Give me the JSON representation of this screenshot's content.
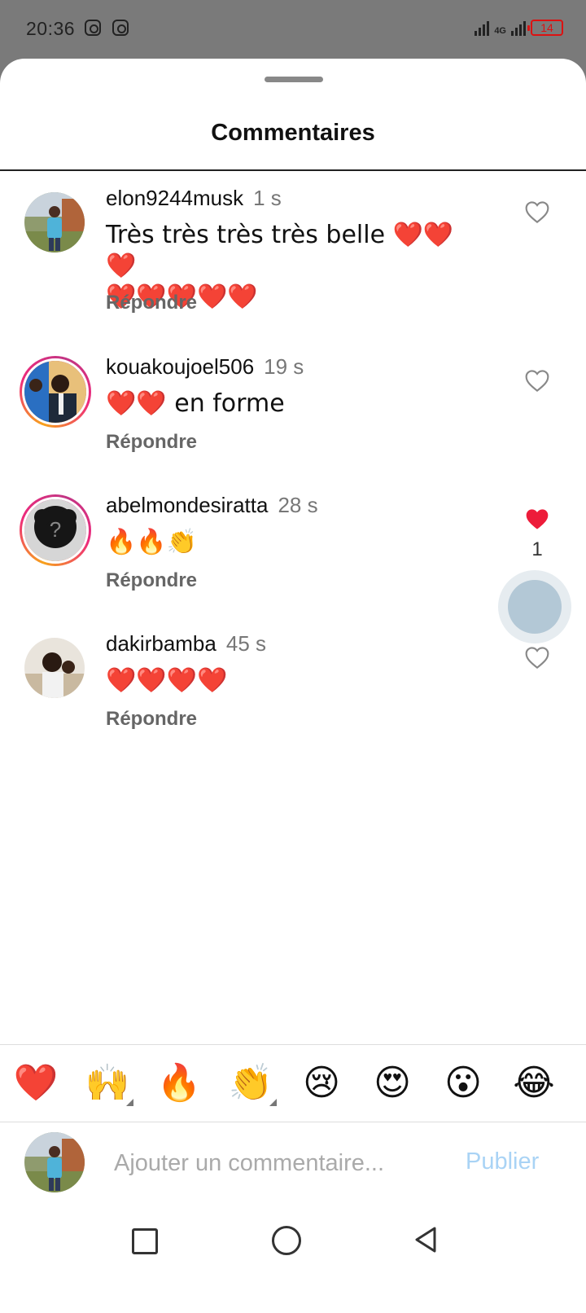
{
  "status_bar": {
    "time": "20:36",
    "network": "4G",
    "battery": "14"
  },
  "sheet": {
    "title": "Commentaires"
  },
  "comments": [
    {
      "username": "elon9244musk",
      "time": "1 s",
      "line1": "Très très très très belle ❤️❤️❤️",
      "line2": "❤️❤️❤️❤️❤️",
      "reply": "Répondre",
      "liked": false,
      "like_count": ""
    },
    {
      "username": "kouakoujoel506",
      "time": "19 s",
      "line1": "❤️❤️ en forme",
      "line2": "",
      "reply": "Répondre",
      "liked": false,
      "like_count": ""
    },
    {
      "username": "abelmondesiratta",
      "time": "28 s",
      "line1": "🔥🔥👏",
      "line2": "",
      "reply": "Répondre",
      "liked": true,
      "like_count": "1"
    },
    {
      "username": "dakirbamba",
      "time": "45 s",
      "line1": "❤️❤️❤️❤️",
      "line2": "",
      "reply": "Répondre",
      "liked": false,
      "like_count": ""
    }
  ],
  "emoji_bar": [
    "❤️",
    "🙌",
    "🔥",
    "👏",
    "😢",
    "😍",
    "😮",
    "😂"
  ],
  "composer": {
    "placeholder": "Ajouter un commentaire...",
    "publish": "Publier"
  },
  "colors": {
    "accent_like": "#ed1c3a",
    "publish_disabled": "#a9d3f5",
    "story_ring_start": "#f7a21b",
    "story_ring_end": "#c13584"
  }
}
